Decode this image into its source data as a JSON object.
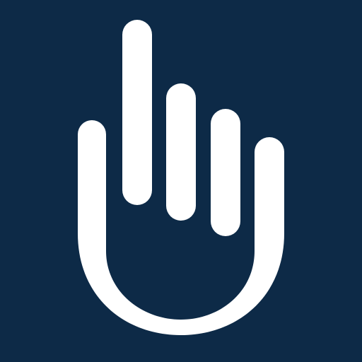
{
  "icon": {
    "name": "raised-hand-icon",
    "background_color": "#0d2a47",
    "foreground_color": "#ffffff"
  }
}
